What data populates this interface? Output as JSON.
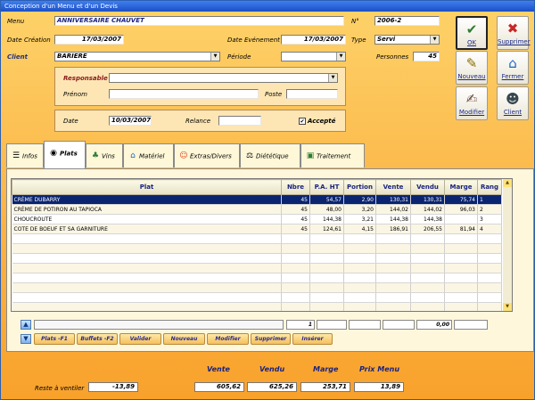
{
  "window": {
    "title": "Conception d'un Menu et d'un Devis"
  },
  "header": {
    "menu_label": "Menu",
    "menu_value": "ANNIVERSAIRE CHAUVET",
    "num_label": "N°",
    "num_value": "2006-2",
    "date_creation_label": "Date Création",
    "date_creation_value": "17/03/2007",
    "date_evenement_label": "Date Evénement",
    "date_evenement_value": "17/03/2007",
    "type_label": "Type",
    "type_value": "Servi",
    "client_label": "Client",
    "client_value": "BARIERE",
    "periode_label": "Période",
    "periode_value": "",
    "personnes_label": "Personnes",
    "personnes_value": "45"
  },
  "contact": {
    "responsable_label": "Responsable",
    "responsable_value": "",
    "prenom_label": "Prénom",
    "prenom_value": "",
    "poste_label": "Poste",
    "poste_value": ""
  },
  "dates": {
    "date_label": "Date",
    "date_value": "10/03/2007",
    "relance_label": "Relance",
    "relance_value": "",
    "accepte_label": "Accepté",
    "accepte_checked": "✔"
  },
  "toolbar": {
    "ok": "OK",
    "supprimer": "Supprimer",
    "nouveau": "Nouveau",
    "fermer": "Fermer",
    "modifier": "Modifier",
    "client": "Client"
  },
  "tabs": [
    "Infos",
    "Plats",
    "Vins",
    "Matériel",
    "Extras/Divers",
    "Diététique",
    "Traitement"
  ],
  "grid": {
    "columns": [
      "Plat",
      "Nbre",
      "P.A. HT",
      "Portion",
      "Vente",
      "Vendu",
      "Marge",
      "Rang"
    ],
    "rows": [
      [
        "CRÈME DUBARRY",
        "45",
        "54,57",
        "2,90",
        "130,31",
        "130,31",
        "75,74",
        "1"
      ],
      [
        "CRÈME DE POTIRON AU TAPIOCA",
        "45",
        "48,00",
        "3,20",
        "144,02",
        "144,02",
        "96,03",
        "2"
      ],
      [
        "CHOUCROUTE",
        "45",
        "144,38",
        "3,21",
        "144,38",
        "144,38",
        "",
        "3"
      ],
      [
        "COTE DE BOEUF ET SA GARNITURE",
        "45",
        "124,61",
        "4,15",
        "186,91",
        "206,55",
        "81,94",
        "4"
      ]
    ],
    "footer_nbre": "1",
    "footer_vendu": "0,00"
  },
  "actions": {
    "plats": "Plats -F1",
    "buffets": "Buffets -F2",
    "valider": "Valider",
    "nouveau": "Nouveau",
    "modifier": "Modifier",
    "supprimer": "Supprimer",
    "inserer": "Insérer"
  },
  "totals": {
    "reste_label": "Reste à ventiler",
    "reste_value": "-13,89",
    "vente_label": "Vente",
    "vente_value": "605,62",
    "vendu_label": "Vendu",
    "vendu_value": "625,26",
    "marge_label": "Marge",
    "marge_value": "253,71",
    "prix_menu_label": "Prix Menu",
    "prix_menu_value": "13,89"
  },
  "colors": {
    "accent": "#1a237e",
    "selection": "#0a2470",
    "background": "#fcb344"
  }
}
